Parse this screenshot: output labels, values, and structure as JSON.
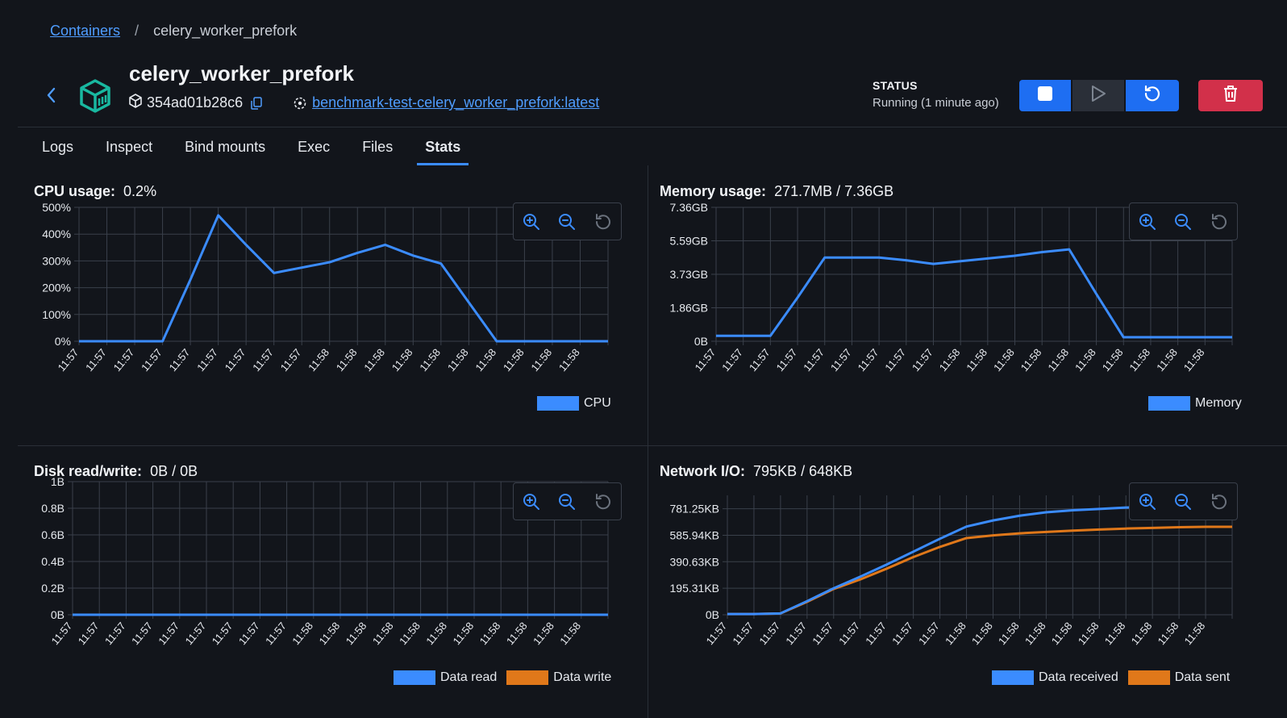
{
  "breadcrumb": {
    "root": "Containers",
    "separator": "/",
    "current": "celery_worker_prefork"
  },
  "container": {
    "name": "celery_worker_prefork",
    "id": "354ad01b28c6",
    "image": "benchmark-test-celery_worker_prefork:latest"
  },
  "status": {
    "label": "STATUS",
    "value": "Running (1 minute ago)"
  },
  "actions": {
    "stop": "stop-icon",
    "start": "play-icon",
    "restart": "restart-icon",
    "delete": "trash-icon"
  },
  "tabs": [
    {
      "label": "Logs"
    },
    {
      "label": "Inspect"
    },
    {
      "label": "Bind mounts"
    },
    {
      "label": "Exec"
    },
    {
      "label": "Files"
    },
    {
      "label": "Stats",
      "active": true
    }
  ],
  "colors": {
    "blue": "#3b8cff",
    "orange": "#e0781a",
    "grid": "#3a404b"
  },
  "stats": {
    "cpu": {
      "label": "CPU usage:",
      "value": "0.2%"
    },
    "memory": {
      "label": "Memory usage:",
      "value": "271.7MB / 7.36GB"
    },
    "disk": {
      "label": "Disk read/write:",
      "value": "0B / 0B"
    },
    "network": {
      "label": "Network I/O:",
      "value": "795KB / 648KB"
    }
  },
  "chart_data": [
    {
      "id": "cpu",
      "type": "line",
      "x": [
        "11:57",
        "11:57",
        "11:57",
        "11:57",
        "11:57",
        "11:57",
        "11:57",
        "11:57",
        "11:57",
        "11:58",
        "11:58",
        "11:58",
        "11:58",
        "11:58",
        "11:58",
        "11:58",
        "11:58",
        "11:58",
        "11:58",
        "11:58"
      ],
      "yticks": [
        "0%",
        "100%",
        "200%",
        "300%",
        "400%",
        "500%"
      ],
      "ylim": [
        0,
        500
      ],
      "series": [
        {
          "name": "CPU",
          "color": "#3b8cff",
          "values": [
            0,
            0,
            0,
            0,
            230,
            470,
            360,
            255,
            275,
            295,
            330,
            360,
            320,
            290,
            145,
            0,
            0,
            0,
            0,
            0
          ]
        }
      ]
    },
    {
      "id": "memory",
      "type": "line",
      "x": [
        "11:57",
        "11:57",
        "11:57",
        "11:57",
        "11:57",
        "11:57",
        "11:57",
        "11:57",
        "11:57",
        "11:58",
        "11:58",
        "11:58",
        "11:58",
        "11:58",
        "11:58",
        "11:58",
        "11:58",
        "11:58",
        "11:58",
        "11:58"
      ],
      "yticks": [
        "0B",
        "1.86GB",
        "3.73GB",
        "5.59GB",
        "7.36GB"
      ],
      "ylim": [
        0,
        7.36
      ],
      "series": [
        {
          "name": "Memory",
          "color": "#3b8cff",
          "values": [
            0.3,
            0.3,
            0.3,
            2.4,
            4.6,
            4.6,
            4.6,
            4.45,
            4.25,
            4.4,
            4.55,
            4.7,
            4.9,
            5.05,
            2.6,
            0.22,
            0.22,
            0.22,
            0.22,
            0.22
          ]
        }
      ]
    },
    {
      "id": "disk",
      "type": "line",
      "x": [
        "11:57",
        "11:57",
        "11:57",
        "11:57",
        "11:57",
        "11:57",
        "11:57",
        "11:57",
        "11:57",
        "11:58",
        "11:58",
        "11:58",
        "11:58",
        "11:58",
        "11:58",
        "11:58",
        "11:58",
        "11:58",
        "11:58",
        "11:58",
        "11:58"
      ],
      "yticks": [
        "0B",
        "0.2B",
        "0.4B",
        "0.6B",
        "0.8B",
        "1B"
      ],
      "ylim": [
        0,
        1
      ],
      "series": [
        {
          "name": "Data read",
          "color": "#3b8cff",
          "values": [
            0,
            0,
            0,
            0,
            0,
            0,
            0,
            0,
            0,
            0,
            0,
            0,
            0,
            0,
            0,
            0,
            0,
            0,
            0,
            0,
            0
          ]
        },
        {
          "name": "Data write",
          "color": "#e0781a",
          "values": [
            0,
            0,
            0,
            0,
            0,
            0,
            0,
            0,
            0,
            0,
            0,
            0,
            0,
            0,
            0,
            0,
            0,
            0,
            0,
            0,
            0
          ]
        }
      ]
    },
    {
      "id": "network",
      "type": "line",
      "x": [
        "11:57",
        "11:57",
        "11:57",
        "11:57",
        "11:57",
        "11:57",
        "11:57",
        "11:57",
        "11:57",
        "11:58",
        "11:58",
        "11:58",
        "11:58",
        "11:58",
        "11:58",
        "11:58",
        "11:58",
        "11:58",
        "11:58",
        "11:58"
      ],
      "yticks": [
        "0B",
        "195.31KB",
        "390.63KB",
        "585.94KB",
        "781.25KB"
      ],
      "ylim": [
        0,
        781.25
      ],
      "ytop": 880,
      "series": [
        {
          "name": "Data received",
          "color": "#3b8cff",
          "values": [
            5,
            5,
            10,
            100,
            195,
            280,
            370,
            465,
            560,
            650,
            695,
            730,
            755,
            770,
            780,
            790,
            795,
            795,
            795,
            795
          ]
        },
        {
          "name": "Data sent",
          "color": "#e0781a",
          "values": [
            5,
            5,
            10,
            95,
            190,
            260,
            340,
            425,
            500,
            565,
            585,
            600,
            610,
            620,
            628,
            635,
            640,
            645,
            648,
            648
          ]
        }
      ]
    }
  ],
  "zoom_controls": {
    "zoom_in": "zoom-in-icon",
    "zoom_out": "zoom-out-icon",
    "reset": "reset-zoom-icon"
  }
}
